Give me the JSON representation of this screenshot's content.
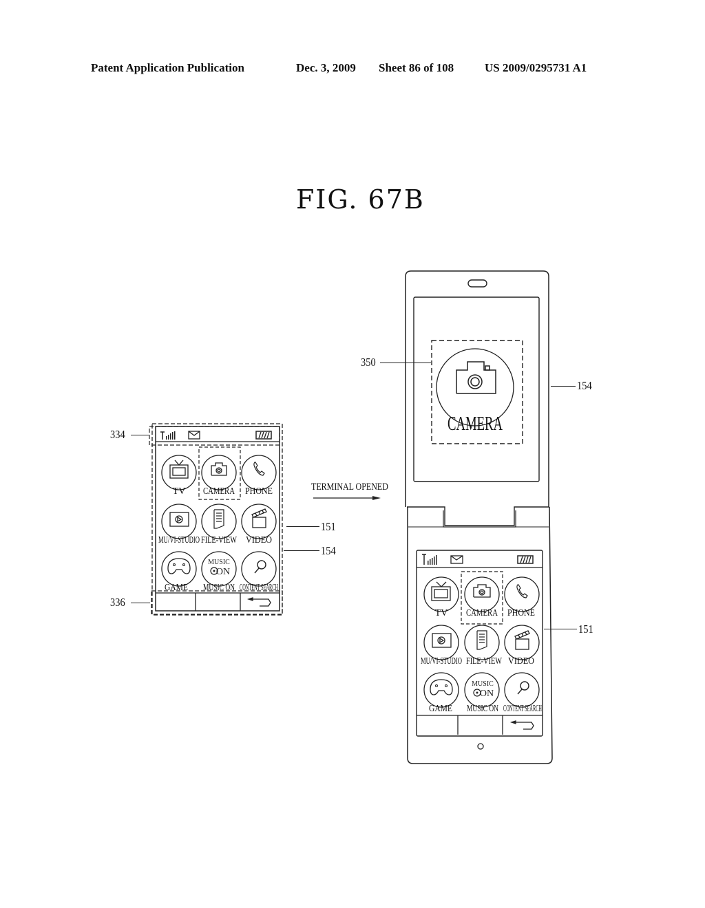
{
  "header": {
    "publication": "Patent Application Publication",
    "date": "Dec. 3, 2009",
    "sheet": "Sheet 86 of 108",
    "patent_number": "US 2009/0295731 A1"
  },
  "figure": {
    "title": "FIG. 67B"
  },
  "transition": {
    "label": "TERMINAL OPENED"
  },
  "reference_numerals": {
    "status_bar": "334",
    "soft_key_bar": "336",
    "display_151_closed": "151",
    "display_154_closed": "154",
    "selected_item_350": "350",
    "display_154_open": "154",
    "display_151_open": "151"
  },
  "closed_terminal": {
    "status_bar": {
      "icons": [
        "signal-strength-icon",
        "message-envelope-icon",
        "battery-icon"
      ]
    },
    "menu_items": [
      {
        "label": "TV",
        "icon": "tv-icon"
      },
      {
        "label": "CAMERA",
        "icon": "camera-icon",
        "selected": true
      },
      {
        "label": "PHONE",
        "icon": "phone-handset-icon"
      },
      {
        "label": "MU/VI-STUDIO",
        "icon": "media-play-icon"
      },
      {
        "label": "FILE-VIEW",
        "icon": "document-icon"
      },
      {
        "label": "VIDEO",
        "icon": "clapperboard-icon"
      },
      {
        "label": "GAME",
        "icon": "gamepad-icon"
      },
      {
        "label": "MUSIC ON",
        "icon": "music-on-icon",
        "icon_text": [
          "MUSIC",
          "ON"
        ]
      },
      {
        "label": "CONTENT SEARCH",
        "icon": "magnifier-icon"
      }
    ],
    "soft_keys": [
      "",
      "",
      "back-arrow-icon"
    ]
  },
  "open_terminal": {
    "upper_display": {
      "selected_label": "CAMERA",
      "selected_icon": "camera-icon"
    },
    "status_bar": {
      "icons": [
        "signal-strength-icon",
        "message-envelope-icon",
        "battery-icon"
      ]
    },
    "menu_items": [
      {
        "label": "TV",
        "icon": "tv-icon"
      },
      {
        "label": "CAMERA",
        "icon": "camera-icon",
        "selected": true
      },
      {
        "label": "PHONE",
        "icon": "phone-handset-icon"
      },
      {
        "label": "MU/VI-STUDIO",
        "icon": "media-play-icon"
      },
      {
        "label": "FILE-VIEW",
        "icon": "document-icon"
      },
      {
        "label": "VIDEO",
        "icon": "clapperboard-icon"
      },
      {
        "label": "GAME",
        "icon": "gamepad-icon"
      },
      {
        "label": "MUSIC ON",
        "icon": "music-on-icon",
        "icon_text": [
          "MUSIC",
          "ON"
        ]
      },
      {
        "label": "CONTENT SEARCH",
        "icon": "magnifier-icon"
      }
    ],
    "soft_keys": [
      "",
      "",
      "back-arrow-icon"
    ]
  }
}
